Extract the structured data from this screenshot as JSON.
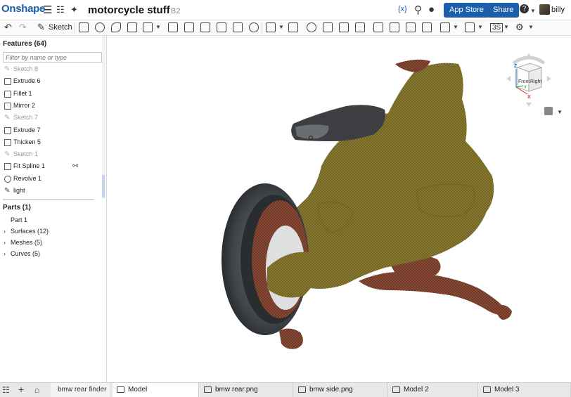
{
  "header": {
    "logo": "Onshape",
    "title": "motorcycle stuff",
    "branch": "B2",
    "variable_icon": "{x}",
    "app_store_label": "App Store",
    "share_label": "Share",
    "help_icon": "?",
    "user": "billy"
  },
  "toolbar": {
    "sketch_label": "Sketch",
    "view_mode_label": "3S"
  },
  "features": {
    "heading": "Features (64)",
    "filter_placeholder": "Filter by name or type",
    "items": [
      {
        "label": "Sketch 8",
        "type": "sketch",
        "disabled": true
      },
      {
        "label": "Extrude 6",
        "type": "extrude",
        "disabled": false
      },
      {
        "label": "Fillet 1",
        "type": "fillet",
        "disabled": false
      },
      {
        "label": "Mirror 2",
        "type": "mirror",
        "disabled": false
      },
      {
        "label": "Sketch 7",
        "type": "sketch",
        "disabled": true
      },
      {
        "label": "Extrude 7",
        "type": "extrude",
        "disabled": false
      },
      {
        "label": "Thicken 5",
        "type": "thicken",
        "disabled": false
      },
      {
        "label": "Sketch 1",
        "type": "sketch",
        "disabled": true
      },
      {
        "label": "Fit Spline 1",
        "type": "fit-spline",
        "disabled": false
      },
      {
        "label": "Revolve 1",
        "type": "revolve",
        "disabled": false
      },
      {
        "label": "light",
        "type": "sketch",
        "disabled": false
      }
    ]
  },
  "parts": {
    "heading": "Parts (1)",
    "items": [
      {
        "label": "Part 1"
      },
      {
        "label": "Surfaces (12)"
      },
      {
        "label": "Meshes (5)"
      },
      {
        "label": "Curves (5)"
      }
    ]
  },
  "nav_cube": {
    "front": "Front",
    "right": "Right",
    "axis_x": "X",
    "axis_y": "Y",
    "axis_z": "Z"
  },
  "tabs": {
    "folder_tab": "bmw rear finder",
    "items": [
      {
        "label": "Model",
        "active": true
      },
      {
        "label": "bmw rear.png",
        "active": false
      },
      {
        "label": "bmw side.png",
        "active": false
      },
      {
        "label": "Model 2",
        "active": false
      },
      {
        "label": "Model 3",
        "active": false
      }
    ]
  },
  "colors": {
    "brand": "#1b5faa",
    "mesh_olive": "#8a7a2e",
    "mesh_rust": "#8b4a35",
    "tire": "#3f4347"
  }
}
